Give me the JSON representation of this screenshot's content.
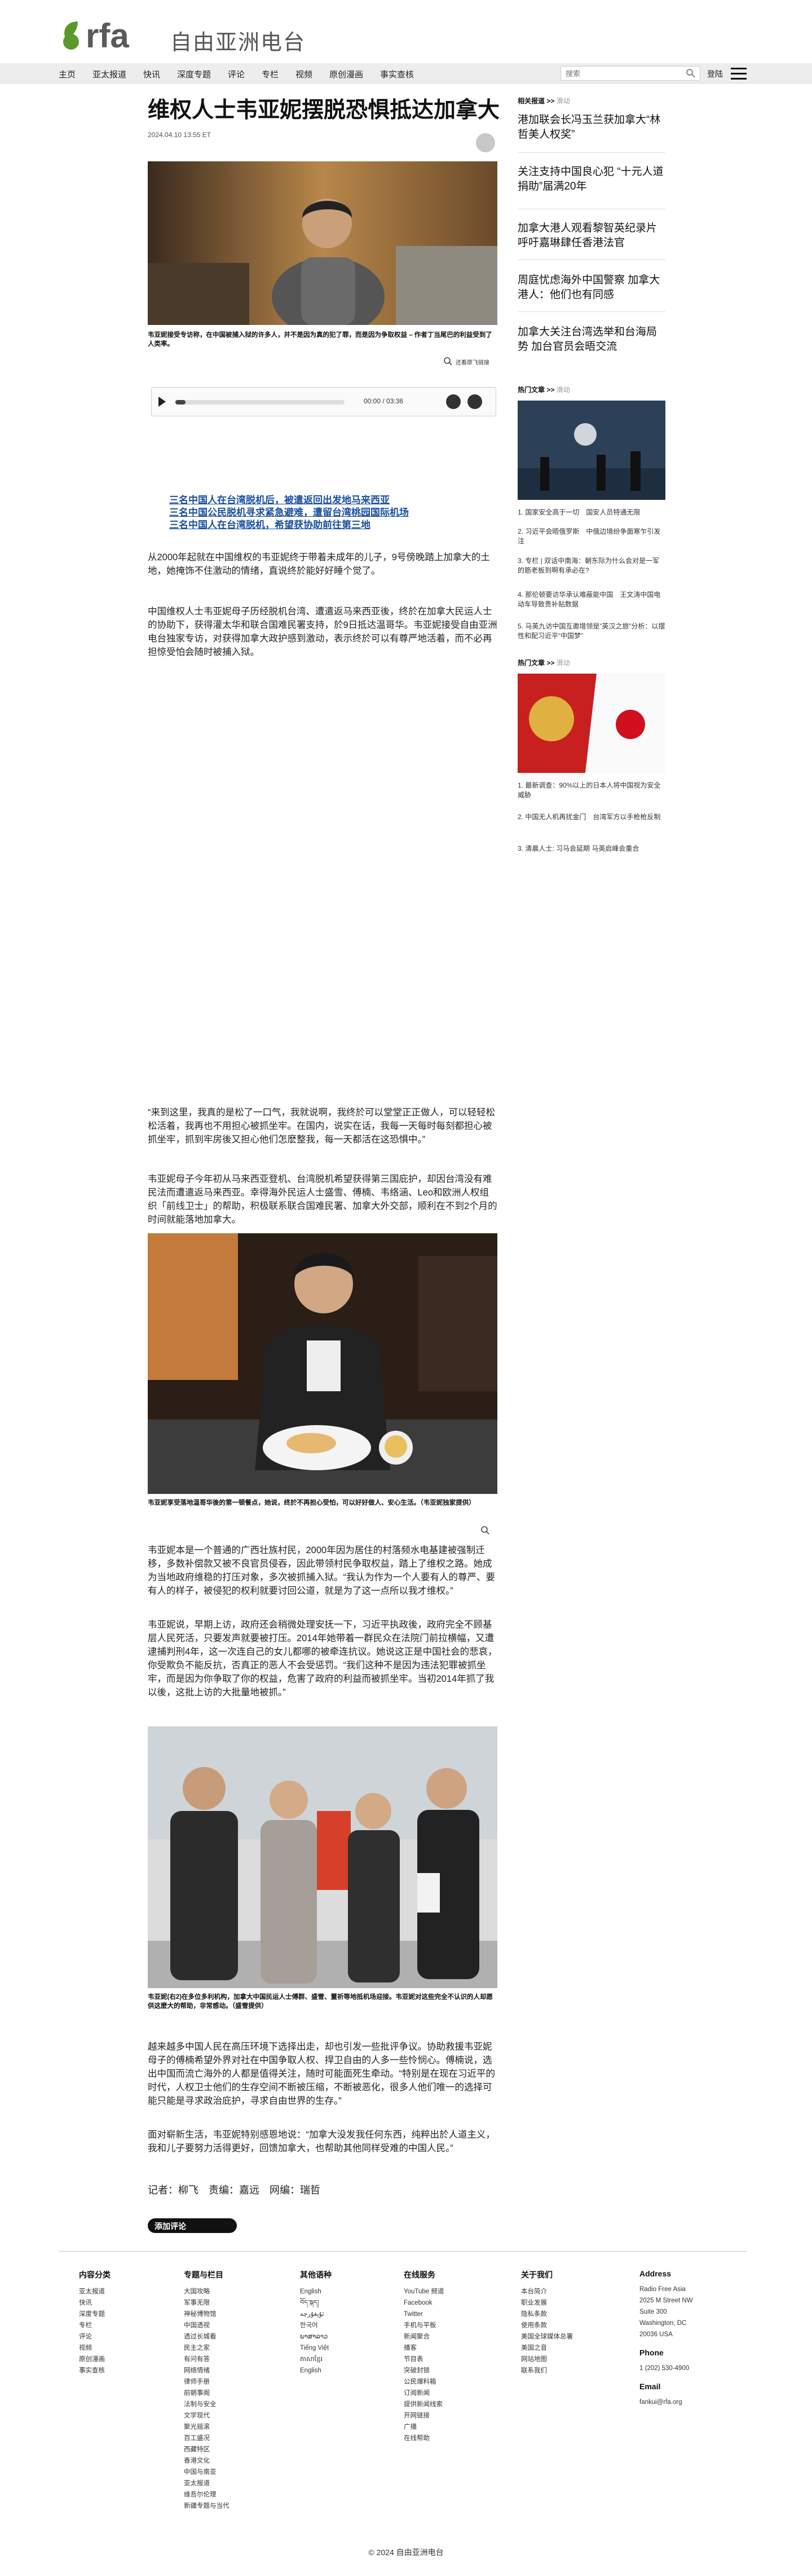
{
  "header": {
    "site_name": "自由亚洲电台",
    "nav": [
      "主页",
      "亚太报道",
      "快讯",
      "深度专题",
      "评论",
      "专栏",
      "视频",
      "原创漫画",
      "事实查核"
    ],
    "search_placeholder": "搜索",
    "login_label": "登陆"
  },
  "article": {
    "title": "维权人士韦亚妮摆脱恐惧抵达加拿大",
    "date": "2024.04.10 13:55 ET",
    "photo1_caption": "韦亚妮接受专访称，在中国被捕入狱的许多人，并不是因为真的犯了罪，而是因为争取权益 – 作者丁当尾巴的利益受到了人类率。",
    "original_size_label": "还看原飞链接",
    "audio": {
      "time": "00:00 / 03:36"
    },
    "related_links": [
      "三名中国人在台湾脱机后，被遣返回出发地马来西亚",
      "三名中国公民脱机寻求紧急避难，遭留台湾桃园国际机场",
      "三名中国人在台湾脱机，希望获协助前往第三地"
    ],
    "paragraphs": [
      "从2000年起就在中国维权的韦亚妮终于带着未成年的儿子，9号傍晚踏上加拿大的土地，她掩饰不住激动的情绪，直说终於能好好睡个觉了。",
      "中国维权人士韦亚妮母子历经脱机台湾、遭遣返马来西亚後，终於在加拿大民运人士的协助下，获得灌太华和联合国难民署支持，於9日抵达温哥华。韦亚妮接受自由亚洲电台独家专访，对获得加拿大政护感到激动，表示终於可以有尊严地活着，而不必再担惊受怕会随时被捕入狱。",
      "“来到这里，我真的是松了一口气，我就说啊，我终於可以堂堂正正做人，可以轻轻松松活着，我再也不用担心被抓坐牢。在国内，说实在话，我每一天每时每刻都担心被抓坐牢，抓到牢房後又担心他们怎麽整我，每一天都活在这恐惧中。”",
      "韦亚妮母子今年初从马来西亚登机、台湾脱机希望获得第三国庇护，却因台湾没有难民法而遭遣返马来西亚。幸得海外民运人士盛雪、傅楠、韦络涵、Leo和欧洲人权组织「前线卫士」的帮助，积极联系联合国难民署、加拿大外交部，顺利在不到2个月的时间就能落地加拿大。",
      "韦亚妮本是一个普通的广西壮族村民，2000年因为居住的村落频水电基建被强制迁移，多数补偿款又被不良官员侵吞，因此带领村民争取权益，踏上了维权之路。她成为当地政府维稳的打压对象，多次被抓捕入狱。“我认为作为一个人要有人的尊严、要有人的样子，被侵犯的权利就要讨回公道，就是为了这一点所以我才维权。”",
      "韦亚妮说，早期上访，政府还会稍微处理安抚一下，习近平执政後，政府完全不顾基层人民死活，只要发声就要被打压。2014年她带着一群民众在法院门前拉横幅，又遭逮捕判刑4年，这一次连自己的女儿都哪的被牵连抗议。她说这正是中国社会的悲哀，你受欺负不能反抗，否真正的恶人不会受惩罚。“我们这种不是因为违法犯罪被抓坐牢，而是因为你争取了你的权益，危害了政府的利益而被抓坐牢。当初2014年抓了我以後，这批上访的大批量地被抓。”",
      "越来越多中国人民在高压环境下选择出走，却也引发一些批评争议。协助救援韦亚妮母子的傅楠希望外界对社在中国争取人权、捍卫自由的人多一些怜悯心。傅楠说，选出中国而流亡海外的人都是值得关注，随时可能面死生牵动。“特别是在现在习近平的时代，人权卫士他们的生存空间不断被压缩，不断被恶化，很多人他们唯一的选择可能只能是寻求政治庇护，寻求自由世界的生存。”",
      "面对崭新生活，韦亚妮特别感恩地说：“加拿大没发我任何东西，纯粹出於人道主义，我和儿子要努力活得更好，回馈加拿大，也帮助其他同样受难的中国人民。”"
    ],
    "photo2_caption": "韦亚妮享受落地温哥华後的第一顿餐点，她说，终於不再担心受怕，可以好好做人、安心生活。（韦亚妮独家提供）",
    "photo3_caption": "韦亚妮(右2)在多位多利机构，加拿大中国民运人士傅群、盛雪、董祈等地抵机场迎接。韦亚妮对这些完全不认识的人却愿供这麽大的帮助，非常感动。（盛雪提供）",
    "reporters": "记者：柳飞　责编：嘉远　网编：瑞哲",
    "comment_button": "添加评论"
  },
  "sidebar": {
    "related_title": "相关报道 >>",
    "related_sub": "滑动",
    "related_stories": [
      "港加联会长冯玉兰获加拿大“林哲美人权奖”",
      "关注支持中国良心犯 “十元人道捐助”届满20年",
      "加拿大港人观看黎智英纪录片 呼吁嘉琳肆任香港法官",
      "周庭忧虑海外中国警察 加拿大港人：他们也有同感",
      "加拿大关注台湾选举和台海局势 加台官员会晤交流"
    ],
    "hot_title": "热门文章 >>",
    "hot_sub": "滑动",
    "hot_list1": [
      "1. 国家安全高于一切　国安人员特通无限",
      "2. 习近平会晤俄罗斯　中俄边境纷争面寒乍引发注",
      "3. 专栏 | 双话中南海：朝东际为什么会对是一军的筋老板到啊有承必在?",
      "4. 那伦顿要访华承认难蔽能中国　王文涛中国电动车导致贵补贴数据",
      "5. 马英九访中国互邀增领是”英汉之旅”分析：以摆性和配习近平“中国梦”"
    ],
    "hot_title2": "热门文章 >>",
    "hot_sub2": "滑动",
    "hot_list2": [
      "1. 最新调查：90%以上的日本人将中国视为安全威胁",
      "2. 中国无人机再扰金门　台湾军方以手枪枪反制",
      "3. 清晨人士: 习马会延期 马英启峰会重合"
    ]
  },
  "footer": {
    "columns": [
      {
        "head": "内容分类",
        "items": [
          "亚太报道",
          "快讯",
          "深度专题",
          "专栏",
          "评论",
          "视频",
          "原创漫画",
          "事实查核"
        ]
      },
      {
        "head": "专题与栏目",
        "items": [
          "大国攻略",
          "军事无限",
          "神秘博物馆",
          "中国透视",
          "透过长城看",
          "民主之家",
          "有问有答",
          "网络情绪",
          "律师手册",
          "前朝事阁",
          "法制与安全",
          "文学现代",
          "聚光摇滚",
          "百工盛况",
          "西藏特区",
          "香港文化",
          "中国与南亚",
          "亚太报道",
          "维吾尔伦理",
          "新疆专题与当代"
        ]
      },
      {
        "head": "其他语种",
        "items": [
          "English",
          "བོད་སྐད།",
          "ئۇيغۇرچە",
          "한국어",
          "ພາສາລາວ",
          "Tiếng Việt",
          "ភាសាខ្មែរ",
          "English"
        ]
      },
      {
        "head": "在线服务",
        "items": [
          "YouTube 频道",
          "Facebook",
          "Twitter",
          "手机与平板",
          "新闻聚合",
          "播客",
          "节目表",
          "突破封锁",
          "公民爆料箱",
          "订阅新闻",
          "提供新闻线索",
          "开网链接",
          "广播",
          "在线帮助"
        ]
      },
      {
        "head": "关于我们",
        "items": [
          "本台简介",
          "职业发展",
          "隐私条款",
          "使用条款",
          "美国全球媒体总署",
          "美国之音",
          "网站地图",
          "联系我们"
        ]
      }
    ],
    "address_head": "Address",
    "address": [
      "Radio Free Asia",
      "2025 M Street NW",
      "Suite 300",
      "Washington, DC",
      "20036 USA"
    ],
    "phone_head": "Phone",
    "phone": "1 (202) 530-4900",
    "email_head": "Email",
    "email": "fankui@rfa.org",
    "copyright": "© 2024 自由亚洲电台"
  },
  "colors": {
    "logo_green": "#5a9a2c",
    "link_blue": "#1a4fa0"
  }
}
